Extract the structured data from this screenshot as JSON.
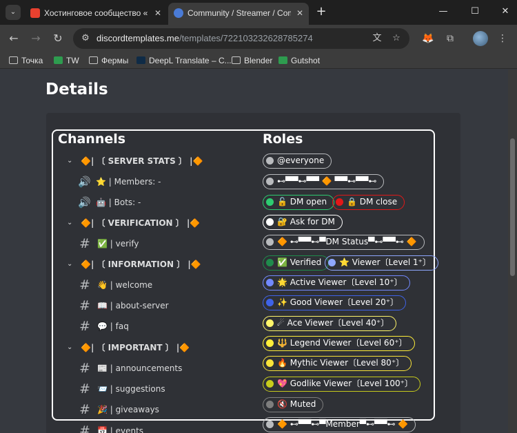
{
  "browser": {
    "tabs": [
      {
        "title": "Хостинговое сообщество «Tim",
        "close": "✕"
      },
      {
        "title": "Community / Streamer / Comm",
        "close": "✕"
      }
    ],
    "new_tab": "+",
    "window_controls": {
      "minimize": "—",
      "maximize": "☐",
      "close": "✕"
    },
    "nav": {
      "back": "←",
      "forward": "→",
      "reload": "↻"
    },
    "url": {
      "domain": "discordtemplates.me",
      "path": "/templates/722103232628785274"
    },
    "bookmarks": [
      "Точка",
      "TW",
      "Фермы",
      "DeepL Translate – C...",
      "Blender",
      "Gutshot"
    ]
  },
  "page": {
    "title": "Details",
    "channels_title": "Channels",
    "roles_title": "Roles",
    "channels": [
      {
        "type": "category",
        "chevron": "⌄",
        "label": "🔶| 〔 SERVER STATS 〕 |🔶"
      },
      {
        "type": "voice",
        "icon": "🔊",
        "label": "⭐ | Members: -"
      },
      {
        "type": "voice",
        "icon": "🔊",
        "label": "🤖 | Bots: -"
      },
      {
        "type": "category",
        "chevron": "⌄",
        "label": "🔶| 〔 VERIFICATION 〕 |🔶"
      },
      {
        "type": "text",
        "icon": "#",
        "label": "✅ | verify"
      },
      {
        "type": "category",
        "chevron": "⌄",
        "label": "🔶| 〔 INFORMATION 〕 |🔶"
      },
      {
        "type": "text",
        "icon": "#",
        "label": "👋 | welcome"
      },
      {
        "type": "text",
        "icon": "#",
        "label": "📖 | about-server"
      },
      {
        "type": "text",
        "icon": "#",
        "label": "💬 | faq"
      },
      {
        "type": "category",
        "chevron": "⌄",
        "label": "🔶| 〔 IMPORTANT 〕 |🔶"
      },
      {
        "type": "text",
        "icon": "#",
        "label": "📰 | announcements"
      },
      {
        "type": "text",
        "icon": "#",
        "label": "📨 | suggestions"
      },
      {
        "type": "text",
        "icon": "#",
        "label": "🎉 | giveaways"
      },
      {
        "type": "text",
        "icon": "#",
        "label": "📅 | events"
      }
    ],
    "roles": [
      [
        {
          "label": "@everyone",
          "color": "#b9bbbe"
        }
      ],
      [
        {
          "label": "⊷▀▀⊷▀▀ 🔶 ▀▀⊷▀▀⊷",
          "color": "#b9bbbe"
        }
      ],
      [
        {
          "label": "🔓 DM open",
          "color": "#2ecc71"
        },
        {
          "label": "🔒 DM close",
          "color": "#e31818"
        }
      ],
      [
        {
          "label": "🔐 Ask for DM",
          "color": "#ffffff"
        }
      ],
      [
        {
          "label": "🔶 ⊷▀▀⊷▀DM Status▀⊷▀▀⊷ 🔶",
          "color": "#b9bbbe"
        }
      ],
      [
        {
          "label": "✅ Verified",
          "color": "#1f8b4c"
        },
        {
          "label": "⭐ Viewer〔Level 1⁺〕",
          "color": "#8fa8ff"
        }
      ],
      [
        {
          "label": "🌟 Active Viewer〔Level 10⁺〕",
          "color": "#7289ff"
        }
      ],
      [
        {
          "label": "✨ Good Viewer〔Level 20⁺〕",
          "color": "#3f63e8"
        }
      ],
      [
        {
          "label": "☄ Ace Viewer〔Level 40⁺〕",
          "color": "#fff56b"
        }
      ],
      [
        {
          "label": "🔱 Legend Viewer〔Level 60⁺〕",
          "color": "#ffee3a"
        }
      ],
      [
        {
          "label": "🔥 Mythic Viewer〔Level 80⁺〕",
          "color": "#f9e33a"
        }
      ],
      [
        {
          "label": "💖 Godlike Viewer〔Level 100⁺〕",
          "color": "#c8cc1c"
        }
      ],
      [
        {
          "label": "🔇 Muted",
          "color": "#7e7e7e"
        }
      ],
      [
        {
          "label": "🔶 ⊷▀▀⊷▀Member▀⊷▀▀⊷ 🔶",
          "color": "#b9bbbe"
        }
      ]
    ]
  }
}
